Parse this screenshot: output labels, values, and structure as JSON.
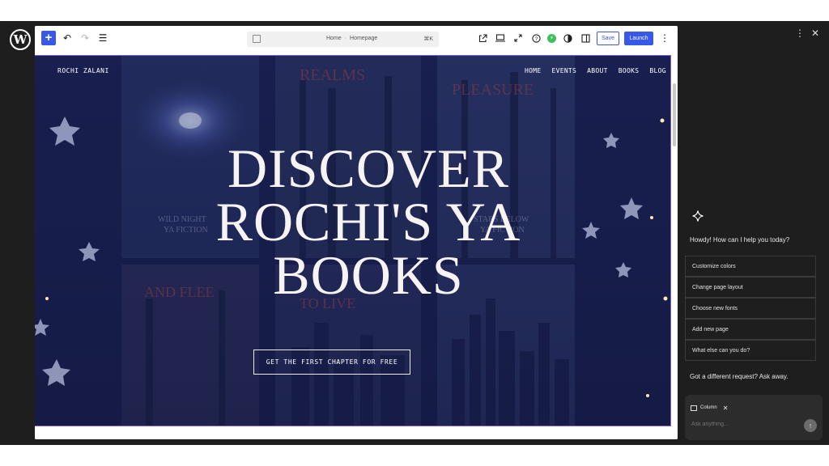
{
  "toolbar": {
    "undo_icon": "↶",
    "redo_icon": "↷",
    "list_icon": "☰",
    "breadcrumb_parent": "Home",
    "breadcrumb_current": "Homepage",
    "shortcut": "⌘K",
    "save_label": "Save",
    "launch_label": "Launch"
  },
  "site": {
    "brand": "ROCHI ZALANI",
    "nav": [
      "HOME",
      "EVENTS",
      "ABOUT",
      "BOOKS",
      "BLOG"
    ],
    "hero_line1": "DISCOVER",
    "hero_line2": "ROCHI'S YA",
    "hero_line3": "BOOKS",
    "cta_label": "GET THE FIRST CHAPTER FOR FREE"
  },
  "assistant": {
    "greeting": "Howdy! How can I help you today?",
    "suggestions": [
      "Customize colors",
      "Change page layout",
      "Choose new fonts",
      "Add new page",
      "What else can you do?"
    ],
    "different_request": "Got a different request? Ask away.",
    "chip_label": "Column",
    "input_placeholder": "Ask anything..."
  },
  "colors": {
    "accent": "#3858e9",
    "hero_bg": "#1c2352",
    "panel_bg": "#1e1e1e"
  }
}
